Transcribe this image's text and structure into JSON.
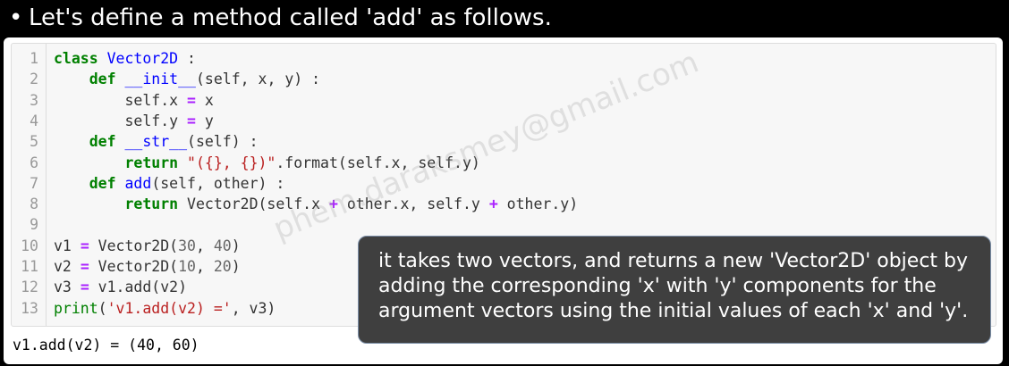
{
  "heading": {
    "bullet": "•",
    "text": "Let's define a method called 'add' as follows."
  },
  "watermark": "phem.daraksmey@gmail.com",
  "code": {
    "line_numbers": [
      "1",
      "2",
      "3",
      "4",
      "5",
      "6",
      "7",
      "8",
      "9",
      "10",
      "11",
      "12",
      "13"
    ],
    "lines": [
      "class Vector2D :",
      "    def __init__(self, x, y) :",
      "        self.x = x",
      "        self.y = y",
      "    def __str__(self) :",
      "        return \"({}, {})\".format(self.x, self.y)",
      "    def add(self, other) :",
      "        return Vector2D(self.x + other.x, self.y + other.y)",
      "",
      "v1 = Vector2D(30, 40)",
      "v2 = Vector2D(10, 20)",
      "v3 = v1.add(v2)",
      "print('v1.add(v2) =', v3)"
    ]
  },
  "output": "v1.add(v2) = (40, 60)",
  "tooltip": {
    "lines": [
      "it takes two vectors, and returns a new 'Vector2D' object by",
      "adding the corresponding 'x' with 'y' components for the",
      "argument vectors using the initial values of each 'x' and 'y'."
    ]
  }
}
